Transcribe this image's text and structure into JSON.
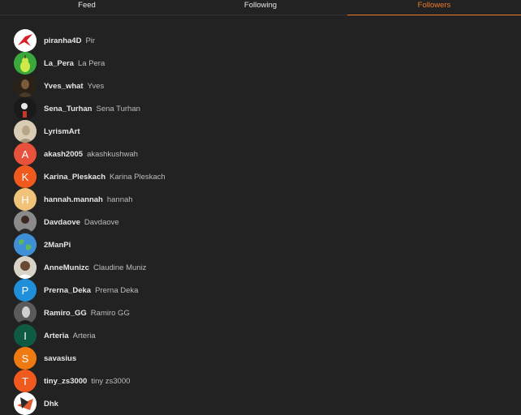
{
  "tabs": [
    {
      "label": "Feed",
      "active": false
    },
    {
      "label": "Following",
      "active": false
    },
    {
      "label": "Followers",
      "active": true
    }
  ],
  "colors": {
    "background": "#222222",
    "accent": "#f07a2a"
  },
  "followers": [
    {
      "username": "piranha4D",
      "display_name": "Pir",
      "avatar": {
        "type": "image",
        "icon": "red-bird-icon",
        "bg": "#ffffff"
      }
    },
    {
      "username": "La_Pera",
      "display_name": "La Pera",
      "avatar": {
        "type": "image",
        "icon": "pear-icon",
        "bg": "#3aa83a"
      }
    },
    {
      "username": "Yves_what",
      "display_name": "Yves",
      "avatar": {
        "type": "image",
        "icon": "portrait-icon",
        "bg": "#2a2218"
      }
    },
    {
      "username": "Sena_Turhan",
      "display_name": "Sena Turhan",
      "avatar": {
        "type": "image",
        "icon": "dark-figure-icon",
        "bg": "#1a1a1a"
      }
    },
    {
      "username": "LyrismArt",
      "display_name": "",
      "avatar": {
        "type": "image",
        "icon": "sketch-portrait-icon",
        "bg": "#d8ccb4"
      }
    },
    {
      "username": "akash2005",
      "display_name": "akashkushwah",
      "avatar": {
        "type": "letter",
        "letter": "A",
        "bg": "#e8513c"
      }
    },
    {
      "username": "Karina_Pleskach",
      "display_name": "Karina Pleskach",
      "avatar": {
        "type": "letter",
        "letter": "K",
        "bg": "#f05a1e"
      }
    },
    {
      "username": "hannah.mannah",
      "display_name": "hannah",
      "avatar": {
        "type": "letter",
        "letter": "H",
        "bg": "#f1c27a"
      }
    },
    {
      "username": "Davdaove",
      "display_name": "Davdaove",
      "avatar": {
        "type": "image",
        "icon": "person-photo-icon",
        "bg": "#8a8a8a"
      }
    },
    {
      "username": "2ManPi",
      "display_name": "",
      "avatar": {
        "type": "image",
        "icon": "globe-icon",
        "bg": "#3f8fd6"
      }
    },
    {
      "username": "AnneMunizc",
      "display_name": "Claudine Muniz",
      "avatar": {
        "type": "image",
        "icon": "smiling-person-icon",
        "bg": "#d9d2c6"
      }
    },
    {
      "username": "Prerna_Deka",
      "display_name": "Prerna Deka",
      "avatar": {
        "type": "letter",
        "letter": "P",
        "bg": "#1e8fd8"
      }
    },
    {
      "username": "Ramiro_GG",
      "display_name": "Ramiro GG",
      "avatar": {
        "type": "image",
        "icon": "bw-portrait-icon",
        "bg": "#5a5a5a"
      }
    },
    {
      "username": "Arteria",
      "display_name": "Arteria",
      "avatar": {
        "type": "letter",
        "letter": "I",
        "bg": "#0f5a43"
      }
    },
    {
      "username": "savasius",
      "display_name": "",
      "avatar": {
        "type": "letter",
        "letter": "S",
        "bg": "#f07a12"
      }
    },
    {
      "username": "tiny_zs3000",
      "display_name": "tiny zs3000",
      "avatar": {
        "type": "letter",
        "letter": "T",
        "bg": "#f05a1e"
      }
    },
    {
      "username": "Dhk",
      "display_name": "",
      "avatar": {
        "type": "image",
        "icon": "abstract-art-icon",
        "bg": "#ffffff"
      }
    }
  ]
}
